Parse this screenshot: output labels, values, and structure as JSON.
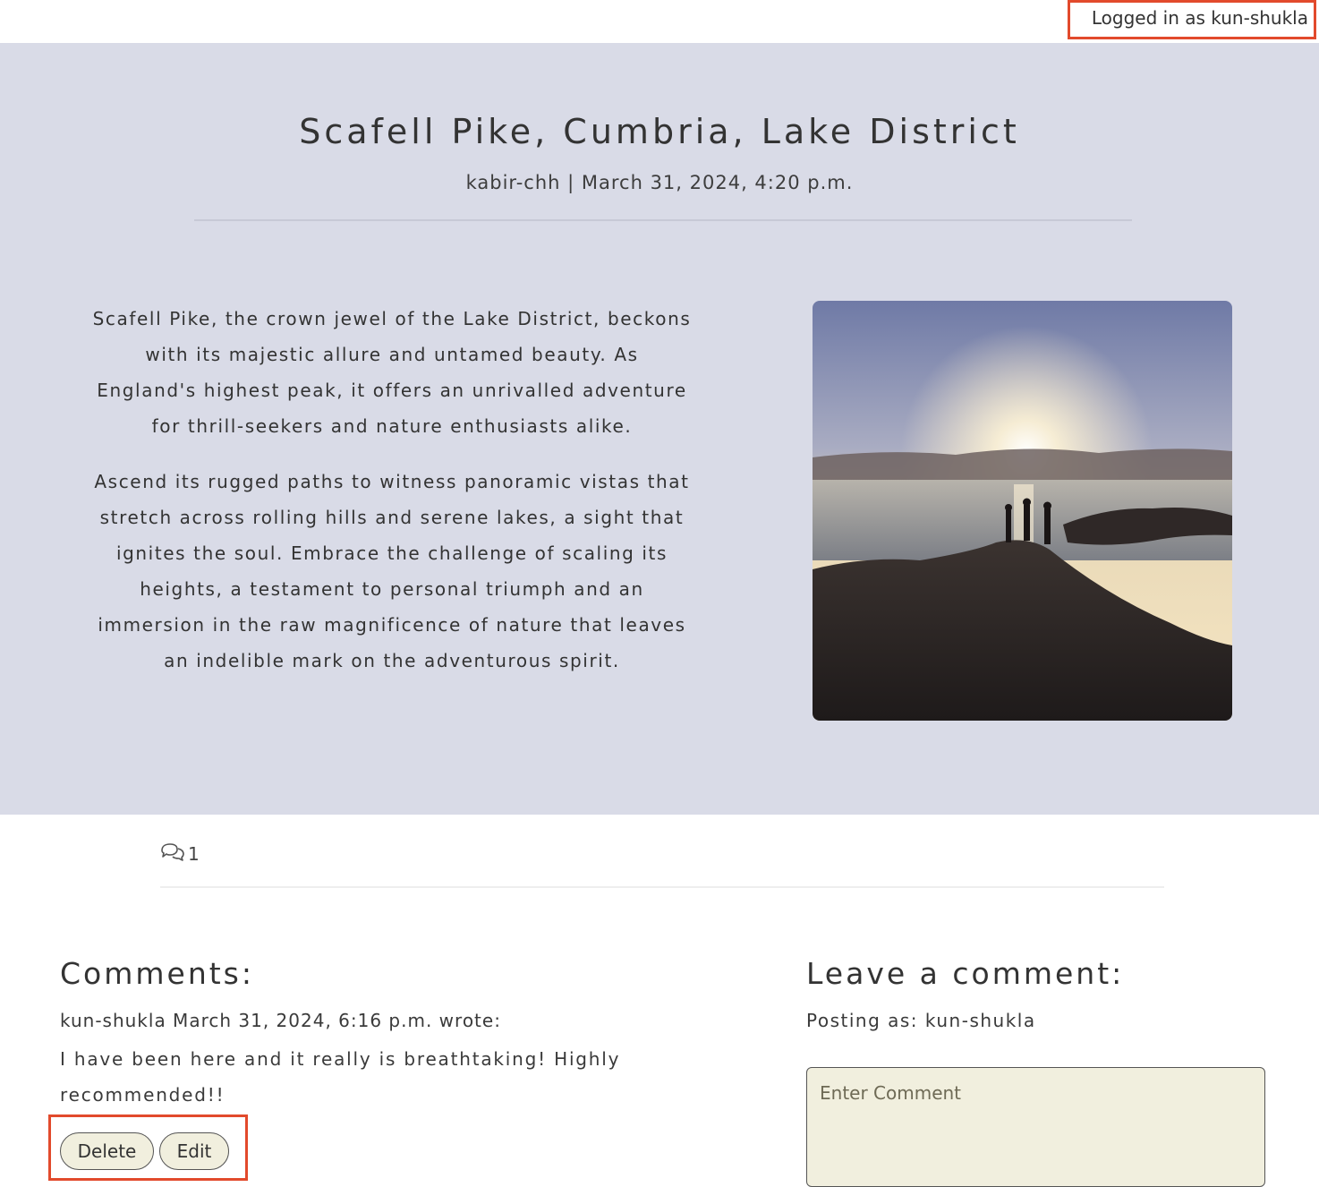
{
  "header": {
    "login_status": "Logged in as kun-shukla"
  },
  "post": {
    "title": "Scafell Pike, Cumbria, Lake District",
    "meta": "kabir-chh | March 31, 2024, 4:20 p.m.",
    "paragraphs": [
      "Scafell Pike, the crown jewel of the Lake District, beckons with its majestic allure and untamed beauty. As England's highest peak, it offers an unrivalled adventure for thrill-seekers and nature enthusiasts alike.",
      "Ascend its rugged paths to witness panoramic vistas that stretch across rolling hills and serene lakes, a sight that ignites the soul. Embrace the challenge of scaling its heights, a testament to personal triumph and an immersion in the raw magnificence of nature that leaves an indelible mark on the adventurous spirit."
    ],
    "image_icon": "landscape-photo",
    "comment_count": "1",
    "comment_icon": "comments-icon"
  },
  "comments": {
    "heading": "Comments:",
    "items": [
      {
        "author_line": "kun-shukla March 31, 2024, 6:16 p.m. wrote:",
        "body": "I have been here and it really is breathtaking! Highly recommended!!",
        "delete_label": "Delete",
        "edit_label": "Edit"
      }
    ]
  },
  "comment_form": {
    "heading": "Leave a comment:",
    "posting_as": "Posting as: kun-shukla",
    "placeholder": "Enter Comment",
    "value": ""
  },
  "colors": {
    "hero_background": "#d9dbe7",
    "button_background": "#f1efde",
    "highlight_border": "#e24a2c"
  }
}
